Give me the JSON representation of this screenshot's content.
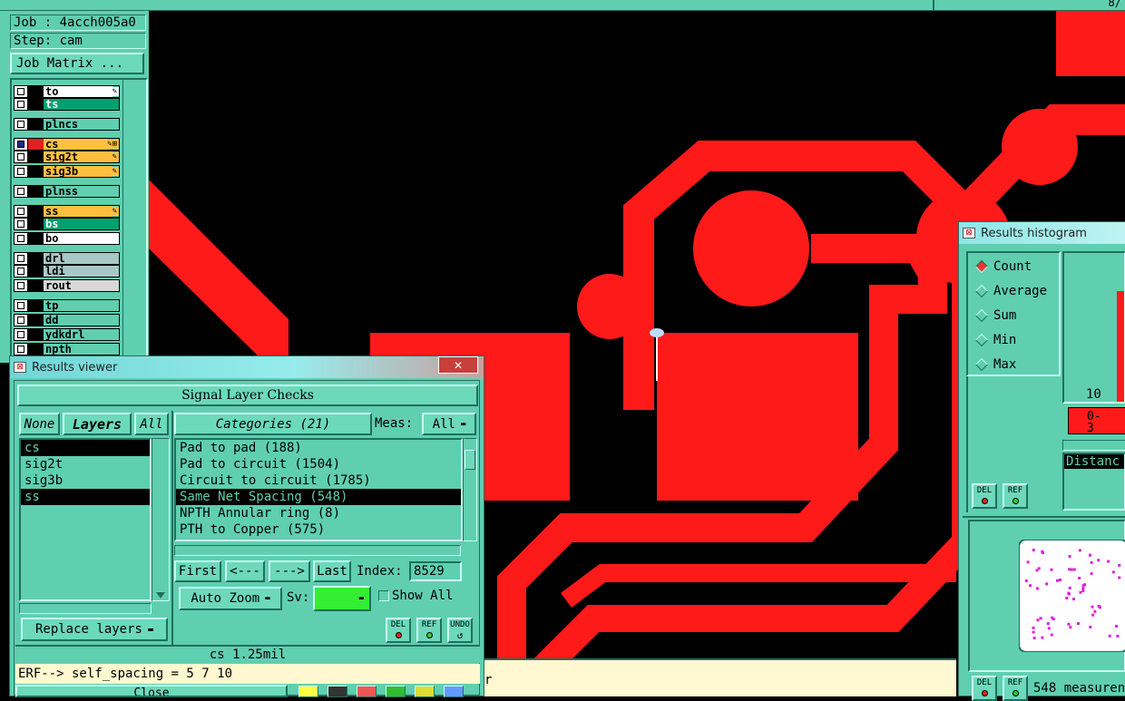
{
  "top_right_text": "8/",
  "left_panel": {
    "job_label": "Job : 4acch005a0",
    "step_label": "Step: cam",
    "job_matrix_button": "Job Matrix ...",
    "layers": [
      {
        "name": "to",
        "color": "#ffffff",
        "sw": "#000000",
        "mark": "edit"
      },
      {
        "name": "ts",
        "color": "#00a070",
        "sw": "#000000",
        "mark": ""
      },
      {
        "name": "plncs",
        "color": "#5fcfb0",
        "sw": "#000000",
        "mark": ""
      },
      {
        "name": "cs",
        "color": "#ffc040",
        "sw": "#e02020",
        "mark": "edit-both",
        "checked": true
      },
      {
        "name": "sig2t",
        "color": "#ffc040",
        "sw": "#000000",
        "mark": "edit"
      },
      {
        "name": "sig3b",
        "color": "#ffc040",
        "sw": "#000000",
        "mark": "edit"
      },
      {
        "name": "plnss",
        "color": "#5fcfb0",
        "sw": "#000000",
        "mark": ""
      },
      {
        "name": "ss",
        "color": "#ffc040",
        "sw": "#000000",
        "mark": "edit"
      },
      {
        "name": "bs",
        "color": "#00a070",
        "sw": "#000000",
        "mark": ""
      },
      {
        "name": "bo",
        "color": "#ffffff",
        "sw": "#000000",
        "mark": ""
      },
      {
        "name": "drl",
        "color": "#a8c8c8",
        "sw": "#000000",
        "mark": ""
      },
      {
        "name": "ldi",
        "color": "#a8c8c8",
        "sw": "#000000",
        "mark": ""
      },
      {
        "name": "rout",
        "color": "#d8d8d8",
        "sw": "#000000",
        "mark": ""
      },
      {
        "name": "tp",
        "color": "#5fcfb0",
        "sw": "#000000",
        "mark": ""
      },
      {
        "name": "dd",
        "color": "#5fcfb0",
        "sw": "#000000",
        "mark": ""
      },
      {
        "name": "ydkdrl",
        "color": "#5fcfb0",
        "sw": "#000000",
        "mark": ""
      },
      {
        "name": "npth",
        "color": "#5fcfb0",
        "sw": "#000000",
        "mark": ""
      }
    ]
  },
  "results_viewer": {
    "title": "Results viewer",
    "close_symbol": "✕",
    "header": "Signal Layer Checks",
    "none_button": "None",
    "layers_button": "Layers",
    "all_button": "All",
    "layer_list": [
      {
        "name": "cs",
        "selected": true
      },
      {
        "name": "sig2t",
        "selected": false
      },
      {
        "name": "sig3b",
        "selected": false
      },
      {
        "name": "ss",
        "selected": true
      }
    ],
    "categories_button": "Categories (21)",
    "meas_label": "Meas:",
    "meas_value": "All",
    "categories": [
      {
        "name": "Pad to pad (188)",
        "selected": false
      },
      {
        "name": "Pad to circuit (1504)",
        "selected": false
      },
      {
        "name": "Circuit to circuit (1785)",
        "selected": false
      },
      {
        "name": "Same Net Spacing (548)",
        "selected": true
      },
      {
        "name": "NPTH Annular ring (8)",
        "selected": false
      },
      {
        "name": "PTH to Copper (575)",
        "selected": false
      }
    ],
    "first_button": "First",
    "prev_button": "<---",
    "next_button": "--->",
    "last_button": "Last",
    "index_label": "Index:",
    "index_value": "8529",
    "auto_zoom": "Auto Zoom",
    "sv_label": "Sv:",
    "sv_color": "#33ee33",
    "show_all": "Show All",
    "replace_layers": "Replace layers",
    "del_label": "DEL",
    "ref_label": "REF",
    "undo_label": "UNDO",
    "status": "cs 1.25mil",
    "erf_text": "ERF--> self_spacing = 5 7 10",
    "close_button": "Close"
  },
  "histogram": {
    "title": "Results histogram",
    "modes": [
      {
        "name": "Count",
        "on": true
      },
      {
        "name": "Average",
        "on": false
      },
      {
        "name": "Sum",
        "on": false
      },
      {
        "name": "Min",
        "on": false
      },
      {
        "name": "Max",
        "on": false
      }
    ],
    "bar_label": "10",
    "bin_label": "0-\n3",
    "distance_label": "Distanc",
    "del_label": "DEL",
    "ref_label": "REF",
    "measure_text": "548 measuren",
    "accent": "#ff1a1a"
  },
  "canvas": {
    "status_snippet": "r"
  }
}
